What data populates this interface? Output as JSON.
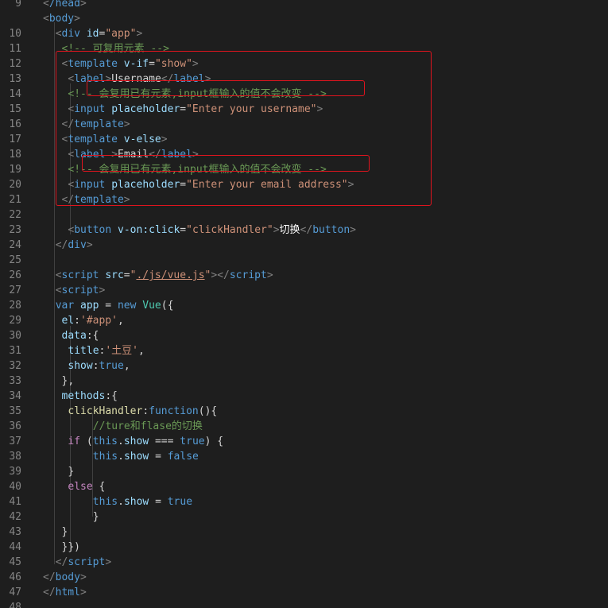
{
  "editor": {
    "theme_colors": {
      "background": "#1e1e1e",
      "tag": "#569cd6",
      "attribute": "#9cdcfe",
      "string": "#ce9178",
      "comment": "#6a9955",
      "control_keyword": "#c586c0",
      "function": "#dcdcaa",
      "class": "#4ec9b0",
      "highlight_box": "#e0141e"
    },
    "lines": [
      {
        "n": "9",
        "indent": 0,
        "tokens": [
          [
            "bracket",
            "<"
          ],
          [
            "tag",
            "/head"
          ],
          [
            "bracket",
            ">"
          ]
        ]
      },
      {
        "n": "",
        "indent": 0,
        "tokens": [
          [
            "bracket",
            "<"
          ],
          [
            "tag",
            "body"
          ],
          [
            "bracket",
            ">"
          ]
        ]
      },
      {
        "n": "10",
        "indent": 2,
        "tokens": [
          [
            "bracket",
            "<"
          ],
          [
            "tag",
            "div"
          ],
          [
            "text",
            " "
          ],
          [
            "attr",
            "id"
          ],
          [
            "text",
            "="
          ],
          [
            "str",
            "\"app\""
          ],
          [
            "bracket",
            ">"
          ]
        ]
      },
      {
        "n": "11",
        "indent": 2,
        "tokens": [
          [
            "comment",
            " <!-- 可复用元素 -->"
          ]
        ]
      },
      {
        "n": "12",
        "indent": 2,
        "tokens": [
          [
            "text",
            " "
          ],
          [
            "bracket",
            "<"
          ],
          [
            "tag",
            "template"
          ],
          [
            "text",
            " "
          ],
          [
            "attr",
            "v-if"
          ],
          [
            "text",
            "="
          ],
          [
            "str",
            "\"show\""
          ],
          [
            "bracket",
            ">"
          ]
        ]
      },
      {
        "n": "13",
        "indent": 4,
        "tokens": [
          [
            "bracket",
            "<"
          ],
          [
            "tag",
            "label"
          ],
          [
            "bracket",
            ">"
          ],
          [
            "text",
            "Username"
          ],
          [
            "bracket",
            "</"
          ],
          [
            "tag",
            "label"
          ],
          [
            "bracket",
            ">"
          ]
        ]
      },
      {
        "n": "14",
        "indent": 4,
        "tokens": [
          [
            "comment",
            "<!-- 会复用已有元素,input框输入的值不会改变 -->"
          ]
        ]
      },
      {
        "n": "15",
        "indent": 4,
        "tokens": [
          [
            "bracket",
            "<"
          ],
          [
            "tag",
            "input"
          ],
          [
            "text",
            " "
          ],
          [
            "attr",
            "placeholder"
          ],
          [
            "text",
            "="
          ],
          [
            "str",
            "\"Enter your username\""
          ],
          [
            "bracket",
            ">"
          ]
        ]
      },
      {
        "n": "16",
        "indent": 2,
        "tokens": [
          [
            "text",
            " "
          ],
          [
            "bracket",
            "</"
          ],
          [
            "tag",
            "template"
          ],
          [
            "bracket",
            ">"
          ]
        ]
      },
      {
        "n": "17",
        "indent": 2,
        "tokens": [
          [
            "text",
            " "
          ],
          [
            "bracket",
            "<"
          ],
          [
            "tag",
            "template"
          ],
          [
            "text",
            " "
          ],
          [
            "attr",
            "v-else"
          ],
          [
            "bracket",
            ">"
          ]
        ]
      },
      {
        "n": "18",
        "indent": 4,
        "tokens": [
          [
            "bracket",
            "<"
          ],
          [
            "tag",
            "label"
          ],
          [
            "text",
            " "
          ],
          [
            "bracket",
            ">"
          ],
          [
            "text",
            "Email"
          ],
          [
            "bracket",
            "</"
          ],
          [
            "tag",
            "label"
          ],
          [
            "bracket",
            ">"
          ]
        ]
      },
      {
        "n": "19",
        "indent": 4,
        "tokens": [
          [
            "comment",
            "<!-- 会复用已有元素,input框输入的值不会改变 -->"
          ]
        ]
      },
      {
        "n": "20",
        "indent": 4,
        "tokens": [
          [
            "bracket",
            "<"
          ],
          [
            "tag",
            "input"
          ],
          [
            "text",
            " "
          ],
          [
            "attr",
            "placeholder"
          ],
          [
            "text",
            "="
          ],
          [
            "str",
            "\"Enter your email address\""
          ],
          [
            "bracket",
            ">"
          ]
        ]
      },
      {
        "n": "21",
        "indent": 2,
        "tokens": [
          [
            "text",
            " "
          ],
          [
            "bracket",
            "</"
          ],
          [
            "tag",
            "template"
          ],
          [
            "bracket",
            ">"
          ]
        ]
      },
      {
        "n": "22",
        "indent": 0,
        "tokens": []
      },
      {
        "n": "23",
        "indent": 4,
        "tokens": [
          [
            "bracket",
            "<"
          ],
          [
            "tag",
            "button"
          ],
          [
            "text",
            " "
          ],
          [
            "attr",
            "v-on:click"
          ],
          [
            "text",
            "="
          ],
          [
            "str",
            "\"clickHandler\""
          ],
          [
            "bracket",
            ">"
          ],
          [
            "cjk",
            "切换"
          ],
          [
            "bracket",
            "</"
          ],
          [
            "tag",
            "button"
          ],
          [
            "bracket",
            ">"
          ]
        ]
      },
      {
        "n": "24",
        "indent": 2,
        "tokens": [
          [
            "bracket",
            "</"
          ],
          [
            "tag",
            "div"
          ],
          [
            "bracket",
            ">"
          ]
        ]
      },
      {
        "n": "25",
        "indent": 0,
        "tokens": []
      },
      {
        "n": "26",
        "indent": 2,
        "tokens": [
          [
            "bracket",
            "<"
          ],
          [
            "tag",
            "script"
          ],
          [
            "text",
            " "
          ],
          [
            "attr",
            "src"
          ],
          [
            "text",
            "="
          ],
          [
            "str",
            "\""
          ],
          [
            "link",
            "./js/vue.js"
          ],
          [
            "str",
            "\""
          ],
          [
            "bracket",
            "></"
          ],
          [
            "tag",
            "script"
          ],
          [
            "bracket",
            ">"
          ]
        ]
      },
      {
        "n": "27",
        "indent": 2,
        "tokens": [
          [
            "bracket",
            "<"
          ],
          [
            "tag",
            "script"
          ],
          [
            "bracket",
            ">"
          ]
        ]
      },
      {
        "n": "28",
        "indent": 2,
        "tokens": [
          [
            "kw",
            "var"
          ],
          [
            "text",
            " "
          ],
          [
            "attr",
            "app"
          ],
          [
            "text",
            " = "
          ],
          [
            "kw",
            "new"
          ],
          [
            "text",
            " "
          ],
          [
            "cls",
            "Vue"
          ],
          [
            "text",
            "({"
          ]
        ]
      },
      {
        "n": "29",
        "indent": 2,
        "tokens": [
          [
            "text",
            " "
          ],
          [
            "attr",
            "el"
          ],
          [
            "text",
            ":"
          ],
          [
            "str",
            "'#app'"
          ],
          [
            "text",
            ","
          ]
        ]
      },
      {
        "n": "30",
        "indent": 2,
        "tokens": [
          [
            "text",
            " "
          ],
          [
            "attr",
            "data"
          ],
          [
            "text",
            ":{"
          ]
        ]
      },
      {
        "n": "31",
        "indent": 4,
        "tokens": [
          [
            "attr",
            "title"
          ],
          [
            "text",
            ":"
          ],
          [
            "str",
            "'土豆'"
          ],
          [
            "text",
            ","
          ]
        ]
      },
      {
        "n": "32",
        "indent": 4,
        "tokens": [
          [
            "attr",
            "show"
          ],
          [
            "text",
            ":"
          ],
          [
            "kw",
            "true"
          ],
          [
            "text",
            ","
          ]
        ]
      },
      {
        "n": "33",
        "indent": 2,
        "tokens": [
          [
            "text",
            " },"
          ]
        ]
      },
      {
        "n": "34",
        "indent": 2,
        "tokens": [
          [
            "text",
            " "
          ],
          [
            "attr",
            "methods"
          ],
          [
            "text",
            ":{"
          ]
        ]
      },
      {
        "n": "35",
        "indent": 4,
        "tokens": [
          [
            "fn",
            "clickHandler"
          ],
          [
            "text",
            ":"
          ],
          [
            "kw",
            "function"
          ],
          [
            "text",
            "(){"
          ]
        ]
      },
      {
        "n": "36",
        "indent": 8,
        "tokens": [
          [
            "comment",
            "//ture和flase的切换"
          ]
        ]
      },
      {
        "n": "37",
        "indent": 4,
        "tokens": [
          [
            "ctrl",
            "if"
          ],
          [
            "text",
            " ("
          ],
          [
            "kw",
            "this"
          ],
          [
            "text",
            "."
          ],
          [
            "attr",
            "show"
          ],
          [
            "text",
            " === "
          ],
          [
            "kw",
            "true"
          ],
          [
            "text",
            ") {"
          ]
        ]
      },
      {
        "n": "38",
        "indent": 8,
        "tokens": [
          [
            "kw",
            "this"
          ],
          [
            "text",
            "."
          ],
          [
            "attr",
            "show"
          ],
          [
            "text",
            " = "
          ],
          [
            "kw",
            "false"
          ]
        ]
      },
      {
        "n": "39",
        "indent": 2,
        "tokens": [
          [
            "text",
            "  }"
          ]
        ]
      },
      {
        "n": "40",
        "indent": 4,
        "tokens": [
          [
            "ctrl",
            "else"
          ],
          [
            "text",
            " {"
          ]
        ]
      },
      {
        "n": "41",
        "indent": 8,
        "tokens": [
          [
            "kw",
            "this"
          ],
          [
            "text",
            "."
          ],
          [
            "attr",
            "show"
          ],
          [
            "text",
            " = "
          ],
          [
            "kw",
            "true"
          ]
        ]
      },
      {
        "n": "42",
        "indent": 8,
        "tokens": [
          [
            "text",
            "}"
          ]
        ]
      },
      {
        "n": "43",
        "indent": 2,
        "tokens": [
          [
            "text",
            " }"
          ]
        ]
      },
      {
        "n": "44",
        "indent": 2,
        "tokens": [
          [
            "text",
            " }})"
          ]
        ]
      },
      {
        "n": "45",
        "indent": 2,
        "tokens": [
          [
            "bracket",
            "</"
          ],
          [
            "tag",
            "script"
          ],
          [
            "bracket",
            ">"
          ]
        ]
      },
      {
        "n": "46",
        "indent": 0,
        "tokens": [
          [
            "bracket",
            "</"
          ],
          [
            "tag",
            "body"
          ],
          [
            "bracket",
            ">"
          ]
        ]
      },
      {
        "n": "47",
        "indent": 0,
        "tokens": [
          [
            "bracket",
            "</"
          ],
          [
            "tag",
            "html"
          ],
          [
            "bracket",
            ">"
          ]
        ]
      },
      {
        "n": "48",
        "indent": 0,
        "tokens": []
      }
    ]
  }
}
